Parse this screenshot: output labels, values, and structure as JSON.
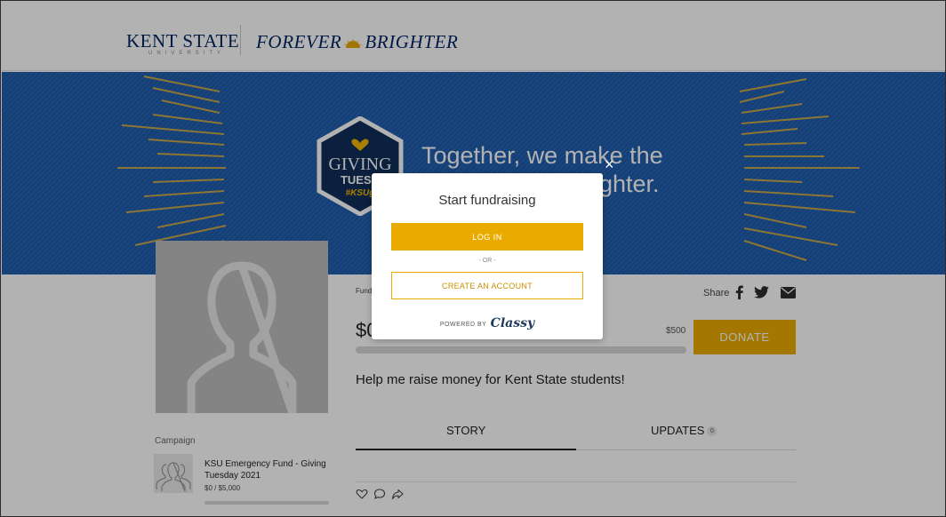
{
  "header": {
    "logo_text": "KENT STATE",
    "logo_sub": "UNIVERSITY",
    "tagline_left": "FOREVER",
    "tagline_right": "BRIGHTER"
  },
  "hero": {
    "badge_line1": "GIVING",
    "badge_line2": "TUESD",
    "badge_line3": "#KSUg",
    "headline_line1": "Together, we make the",
    "headline_line2": "ghter."
  },
  "profile": {
    "campaign_label": "Campaign",
    "campaign_title": "KSU Emergency Fund - Giving Tuesday 2021",
    "campaign_amount": "$0 / $5,000",
    "campaign_progress": 0
  },
  "fundraiser": {
    "fund_label": "Fund",
    "share_label": "Share",
    "raised": "$0",
    "goal": "$500",
    "progress": 0,
    "donate_label": "DONATE",
    "description": "Help me raise money for Kent State students!"
  },
  "tabs": [
    {
      "label": "STORY",
      "active": true
    },
    {
      "label": "UPDATES",
      "badge": "0",
      "active": false
    }
  ],
  "modal": {
    "close_label": "×",
    "title": "Start fundraising",
    "login_label": "LOG IN",
    "or_label": "- OR -",
    "create_label": "CREATE AN ACCOUNT",
    "powered_label": "POWERED BY",
    "powered_brand": "Classy"
  },
  "colors": {
    "brand_navy": "#002664",
    "brand_gold": "#eaab00",
    "hero_blue": "#1f5fb0"
  },
  "icons": {
    "share": [
      "facebook-icon",
      "twitter-icon",
      "email-icon"
    ],
    "reactions": [
      "heart-icon",
      "comment-icon",
      "share-arrow-icon"
    ]
  }
}
